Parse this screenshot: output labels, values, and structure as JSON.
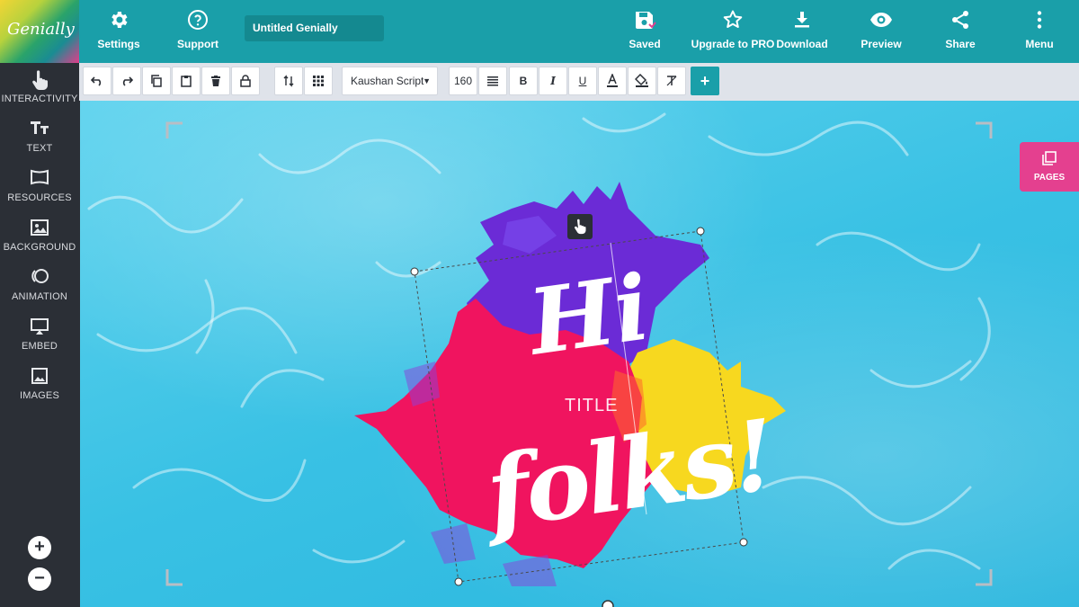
{
  "app": {
    "logo_text": "Genially",
    "title": "Untitled Genially"
  },
  "topbar": {
    "settings": "Settings",
    "support": "Support",
    "saved": "Saved",
    "upgrade": "Upgrade to PRO",
    "download": "Download",
    "preview": "Preview",
    "share": "Share",
    "menu": "Menu"
  },
  "sidebar": {
    "items": [
      {
        "label": "INTERACTIVITY",
        "icon": "hand-pointer-icon"
      },
      {
        "label": "TEXT",
        "icon": "text-icon"
      },
      {
        "label": "RESOURCES",
        "icon": "resources-icon"
      },
      {
        "label": "BACKGROUND",
        "icon": "background-icon"
      },
      {
        "label": "ANIMATION",
        "icon": "animation-icon"
      },
      {
        "label": "EMBED",
        "icon": "embed-icon"
      },
      {
        "label": "IMAGES",
        "icon": "images-icon"
      }
    ],
    "zoom_in": "+",
    "zoom_out": "−"
  },
  "toolbar": {
    "font": "Kaushan Script",
    "font_size": "160",
    "bold": "B",
    "italic": "I",
    "underline": "U",
    "add": "+"
  },
  "canvas": {
    "word1": "Hi",
    "word2": "folks!",
    "title": "TITLE"
  },
  "pages_button": "PAGES",
  "colors": {
    "primary": "#1a9fa9",
    "sidebar": "#2b2f36",
    "pages": "#e4408f",
    "splash_purple": "#6b2bd6",
    "splash_pink": "#f0145f",
    "splash_yellow": "#f7d81f"
  }
}
